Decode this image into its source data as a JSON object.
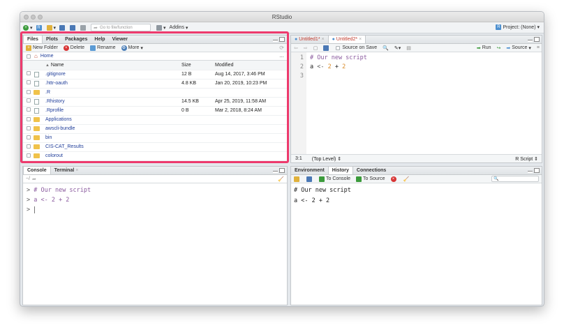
{
  "window": {
    "title": "RStudio"
  },
  "toolbar": {
    "goto_placeholder": "Go to file/function",
    "addins_label": "Addins",
    "project_label": "Project: (None)"
  },
  "files_pane": {
    "tabs": [
      "Files",
      "Plots",
      "Packages",
      "Help",
      "Viewer"
    ],
    "actions": {
      "new_folder": "New Folder",
      "delete": "Delete",
      "rename": "Rename",
      "more": "More"
    },
    "breadcrumb": "Home",
    "columns": {
      "name": "Name",
      "size": "Size",
      "modified": "Modified"
    },
    "rows": [
      {
        "name": ".gitignore",
        "size": "12 B",
        "modified": "Aug 14, 2017, 3:46 PM",
        "kind": "file"
      },
      {
        "name": ".httr-oauth",
        "size": "4.8 KB",
        "modified": "Jan 20, 2019, 10:23 PM",
        "kind": "file"
      },
      {
        "name": ".R",
        "size": "",
        "modified": "",
        "kind": "folder"
      },
      {
        "name": ".Rhistory",
        "size": "14.5 KB",
        "modified": "Apr 25, 2019, 11:58 AM",
        "kind": "file"
      },
      {
        "name": ".Rprofile",
        "size": "0 B",
        "modified": "Mar 2, 2018, 8:24 AM",
        "kind": "file"
      },
      {
        "name": "Applications",
        "size": "",
        "modified": "",
        "kind": "folder"
      },
      {
        "name": "awscli-bundle",
        "size": "",
        "modified": "",
        "kind": "folder"
      },
      {
        "name": "bin",
        "size": "",
        "modified": "",
        "kind": "folder"
      },
      {
        "name": "CIS-CAT_Results",
        "size": "",
        "modified": "",
        "kind": "folder"
      },
      {
        "name": "colorout",
        "size": "",
        "modified": "",
        "kind": "folder"
      }
    ]
  },
  "editor": {
    "tabs": [
      "Untitled1*",
      "Untitled2*"
    ],
    "source_on_save": "Source on Save",
    "run_label": "Run",
    "source_label": "Source",
    "line_numbers": [
      "1",
      "2",
      "3"
    ],
    "code": {
      "line1": "# Our new script",
      "line2_a": "a",
      "line2_op": "<-",
      "line2_n1": "2",
      "line2_plus": "+",
      "line2_n2": "2"
    },
    "status_pos": "3:1",
    "status_scope": "(Top Level)",
    "status_type": "R Script"
  },
  "console_pane": {
    "tabs": [
      "Console",
      "Terminal"
    ],
    "path": "~/",
    "prompt": ">",
    "lines": [
      "# Our new script",
      "a <- 2 + 2"
    ]
  },
  "env_pane": {
    "tabs": [
      "Environment",
      "History",
      "Connections"
    ],
    "to_console": "To Console",
    "to_source": "To Source",
    "history": [
      "# Our new script",
      "a <- 2 + 2"
    ]
  },
  "colors": {
    "highlight": "#ee3a6d",
    "link": "#1f3d99",
    "comment": "#8a5a9e",
    "number": "#d98c2b",
    "prompt": "#555555"
  }
}
